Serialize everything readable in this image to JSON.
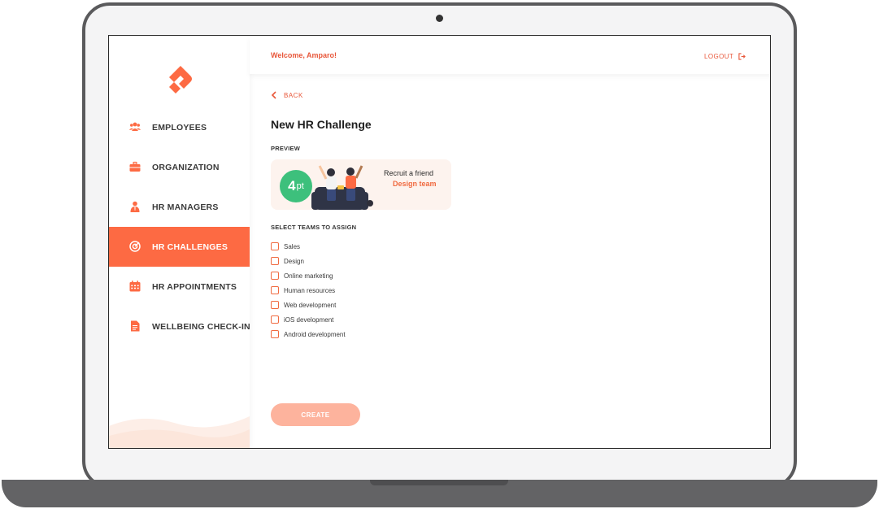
{
  "header": {
    "welcome": "Welcome, Amparo!",
    "logout_label": "LOGOUT"
  },
  "sidebar": {
    "items": [
      {
        "label": "EMPLOYEES",
        "icon": "employees-icon",
        "active": false
      },
      {
        "label": "ORGANIZATION",
        "icon": "briefcase-icon",
        "active": false
      },
      {
        "label": "HR MANAGERS",
        "icon": "manager-icon",
        "active": false
      },
      {
        "label": "HR CHALLENGES",
        "icon": "target-icon",
        "active": true
      },
      {
        "label": "HR APPOINTMENTS",
        "icon": "calendar-icon",
        "active": false
      },
      {
        "label": "WELLBEING CHECK-IN",
        "icon": "document-icon",
        "active": false
      }
    ]
  },
  "main": {
    "back_label": "BACK",
    "title": "New HR Challenge",
    "preview_label": "PREVIEW",
    "preview_card": {
      "points": "4",
      "points_unit": "pt",
      "title": "Recruit a friend",
      "team": "Design team"
    },
    "teams_label": "SELECT TEAMS TO ASSIGN",
    "teams": [
      {
        "label": "Sales",
        "checked": false
      },
      {
        "label": "Design",
        "checked": false
      },
      {
        "label": "Online marketing",
        "checked": false
      },
      {
        "label": "Human resources",
        "checked": false
      },
      {
        "label": "Web development",
        "checked": false
      },
      {
        "label": "iOS development",
        "checked": false
      },
      {
        "label": "Android development",
        "checked": false
      }
    ],
    "create_label": "CREATE"
  },
  "colors": {
    "accent": "#fd6a43",
    "accent_text": "#e8573a",
    "badge_green": "#3dc07c",
    "button_disabled": "#fdb39d"
  }
}
